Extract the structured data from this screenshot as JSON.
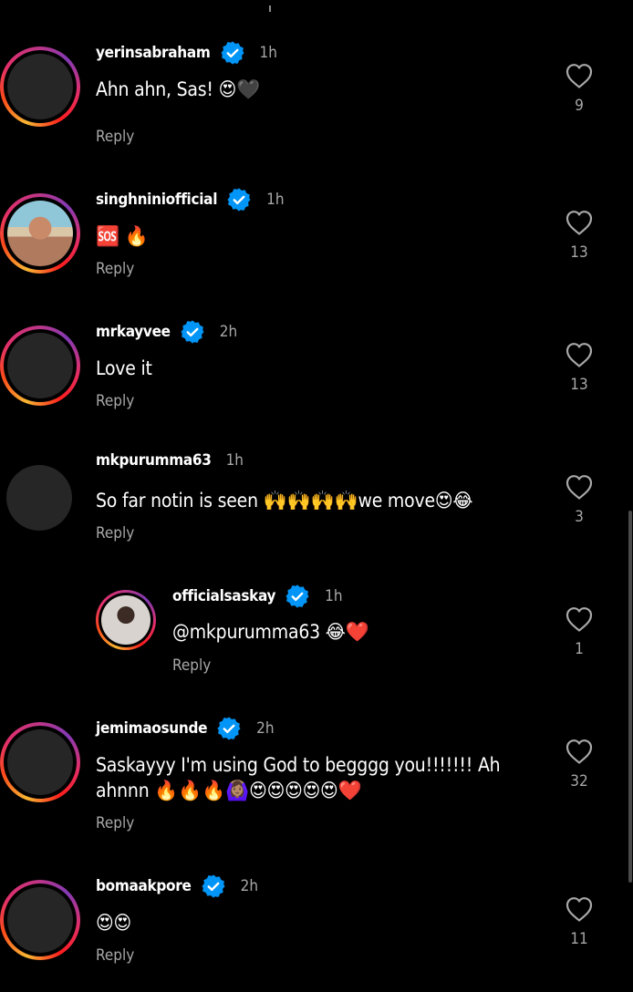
{
  "comments": [
    {
      "username": "yerinsabraham",
      "verified": true,
      "time": "1h",
      "text": "Ahn ahn, Sas! 😍🖤",
      "reply": "Reply",
      "likes": "9"
    },
    {
      "username": "singhniniofficial",
      "verified": true,
      "time": "1h",
      "text": "🆘 🔥",
      "reply": "Reply",
      "likes": "13"
    },
    {
      "username": "mrkayvee",
      "verified": true,
      "time": "2h",
      "text": "Love it",
      "reply": "Reply",
      "likes": "13"
    },
    {
      "username": "mkpurumma63",
      "verified": false,
      "time": "1h",
      "text": "So far notin is seen 🙌🙌🙌🙌we move😍😂",
      "reply": "Reply",
      "likes": "3"
    },
    {
      "username": "officialsaskay",
      "verified": true,
      "time": "1h",
      "text": "@mkpurumma63 😂❤️",
      "reply": "Reply",
      "likes": "1"
    },
    {
      "username": "jemimaosunde",
      "verified": true,
      "time": "2h",
      "text": "Saskayyy I'm using God to begggg you!!!!!!! Ah ahnnn 🔥🔥🔥🙆🏽‍♀️😍😍😍😍😍❤️",
      "reply": "Reply",
      "likes": "32"
    },
    {
      "username": "bomaakpore",
      "verified": true,
      "time": "2h",
      "text": "😍😍",
      "reply": "Reply",
      "likes": "11"
    }
  ],
  "colors": {
    "background": "#000000",
    "text": "#ffffff",
    "secondary": "#a8a8a8",
    "verified": "#0095f6"
  },
  "icons": {
    "verified": "verified-badge-icon",
    "like": "heart-outline-icon"
  }
}
